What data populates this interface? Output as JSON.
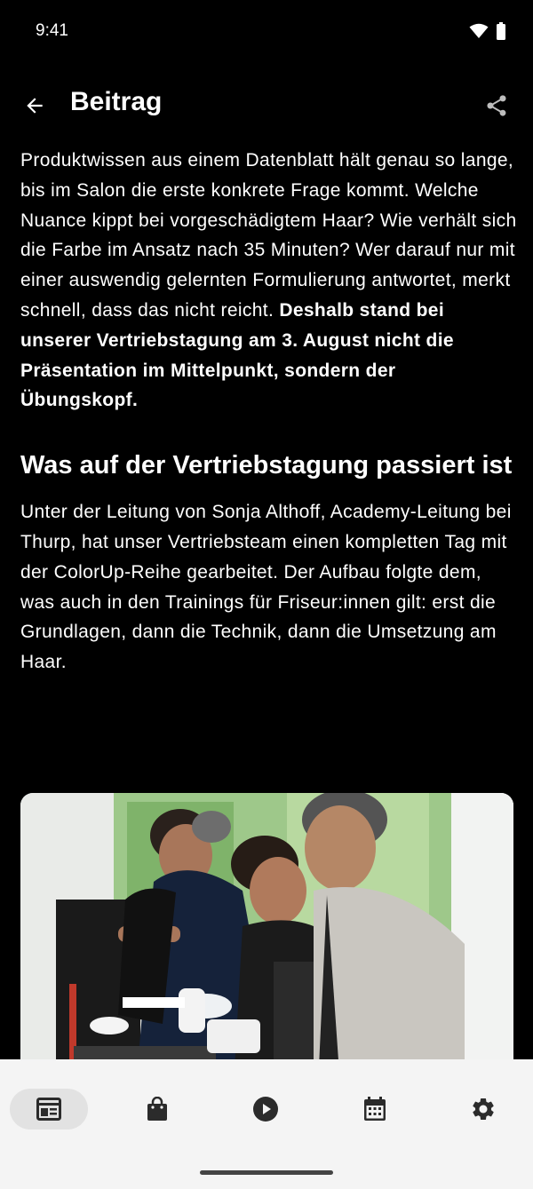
{
  "status": {
    "time": "9:41"
  },
  "header": {
    "title": "Beitrag"
  },
  "article": {
    "intro": "Produktwissen aus einem Datenblatt hält genau so lange, bis im Salon die erste konkrete Frage kommt. Welche Nuance kippt bei vorgeschädigtem Haar? Wie verhält sich die Farbe im Ansatz nach 35 Minuten? Wer darauf nur mit einer auswendig gelernten Formulierung antwortet, merkt schnell, dass das nicht reicht.",
    "intro_bold": "Deshalb stand bei unserer Vertriebstagung am 3. August nicht die Präsentation im Mittelpunkt, sondern der Übungskopf.",
    "heading": "Was auf der Vertriebstagung passiert ist",
    "body": "Unter der Leitung von Sonja Althoff, Academy-Leitung bei Thurp, hat unser Vertriebsteam einen kompletten Tag mit der ColorUp-Reihe gearbeitet. Der Aufbau folgte dem, was auch in den Trainings für Friseur:innen gilt: erst die Grundlagen, dann die Technik, dann die Umsetzung am Haar."
  },
  "nav": {
    "items": [
      {
        "icon": "newspaper-icon",
        "active": true
      },
      {
        "icon": "shopping-bag-icon",
        "active": false
      },
      {
        "icon": "play-circle-icon",
        "active": false
      },
      {
        "icon": "calendar-icon",
        "active": false
      },
      {
        "icon": "settings-gear-icon",
        "active": false
      }
    ]
  },
  "colors": {
    "background": "#000000",
    "text": "#ffffff",
    "nav_background": "#f4f4f4",
    "nav_active": "#e2e2e2",
    "nav_icon": "#2b2b2b"
  }
}
